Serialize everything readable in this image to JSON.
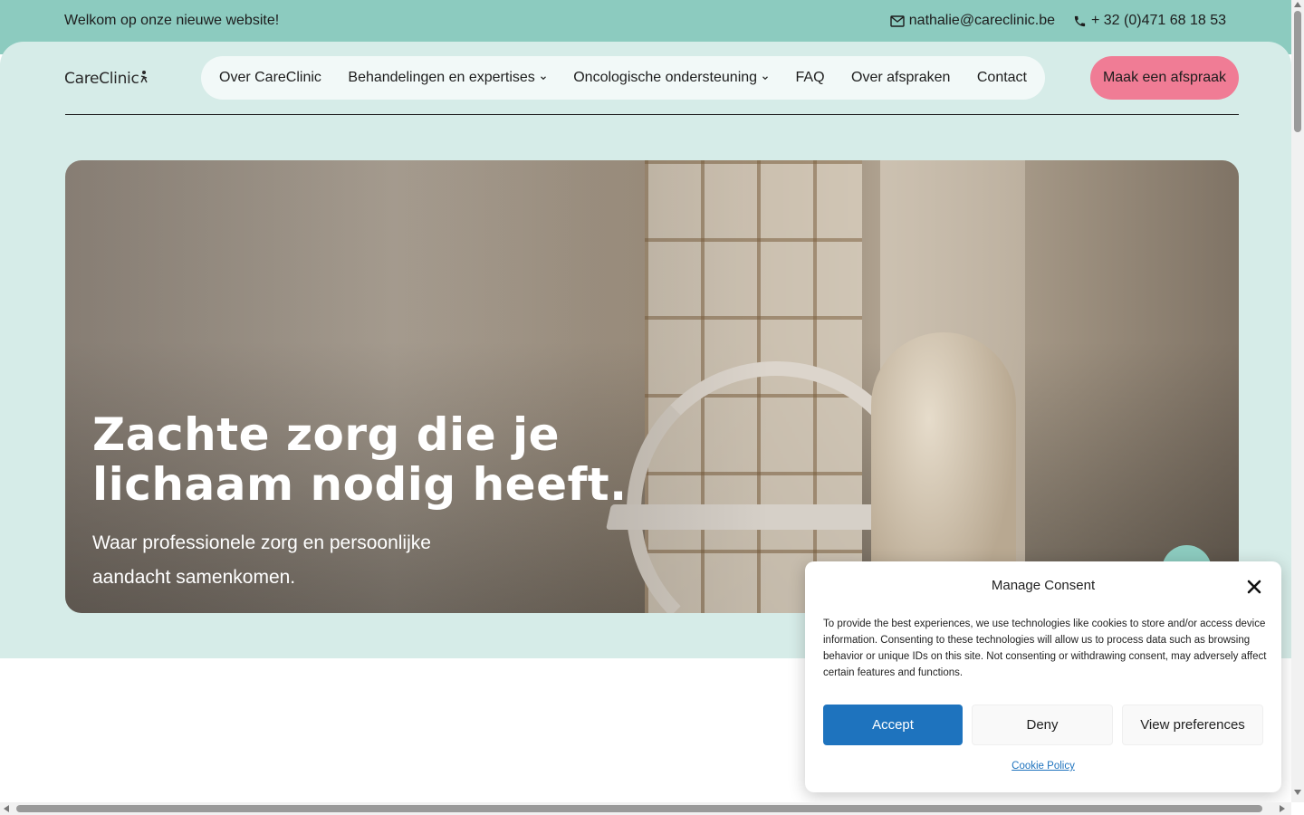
{
  "topbar": {
    "welcome": "Welkom op onze nieuwe website!",
    "email": "nathalie@careclinic.be",
    "phone": "+ 32 (0)471 68 18 53",
    "email_icon": "mail-icon",
    "phone_icon": "phone-icon"
  },
  "logo": {
    "text": "CareClinic"
  },
  "nav": {
    "items": [
      {
        "label": "Over CareClinic",
        "dropdown": false
      },
      {
        "label": "Behandelingen en expertises",
        "dropdown": true
      },
      {
        "label": "Oncologische ondersteuning",
        "dropdown": true
      },
      {
        "label": "FAQ",
        "dropdown": false
      },
      {
        "label": "Over afspraken",
        "dropdown": false
      },
      {
        "label": "Contact",
        "dropdown": false
      }
    ],
    "cta": "Maak een afspraak"
  },
  "hero": {
    "title_line1": "Zachte zorg die je",
    "title_line2": "lichaam nodig heeft.",
    "subtitle_line1": "Waar professionele zorg en persoonlijke",
    "subtitle_line2": "aandacht samenkomen."
  },
  "consent": {
    "title": "Manage Consent",
    "text": "To provide the best experiences, we use technologies like cookies to store and/or access device information. Consenting to these technologies will allow us to process data such as browsing behavior or unique IDs on this site. Not consenting or withdrawing consent, may adversely affect certain features and functions.",
    "accept": "Accept",
    "deny": "Deny",
    "preferences": "View preferences",
    "policy_link": "Cookie Policy"
  },
  "colors": {
    "topbar": "#8ccbbf",
    "header_bg": "#d6ece8",
    "cta": "#f07c95",
    "accept": "#1e73be"
  }
}
